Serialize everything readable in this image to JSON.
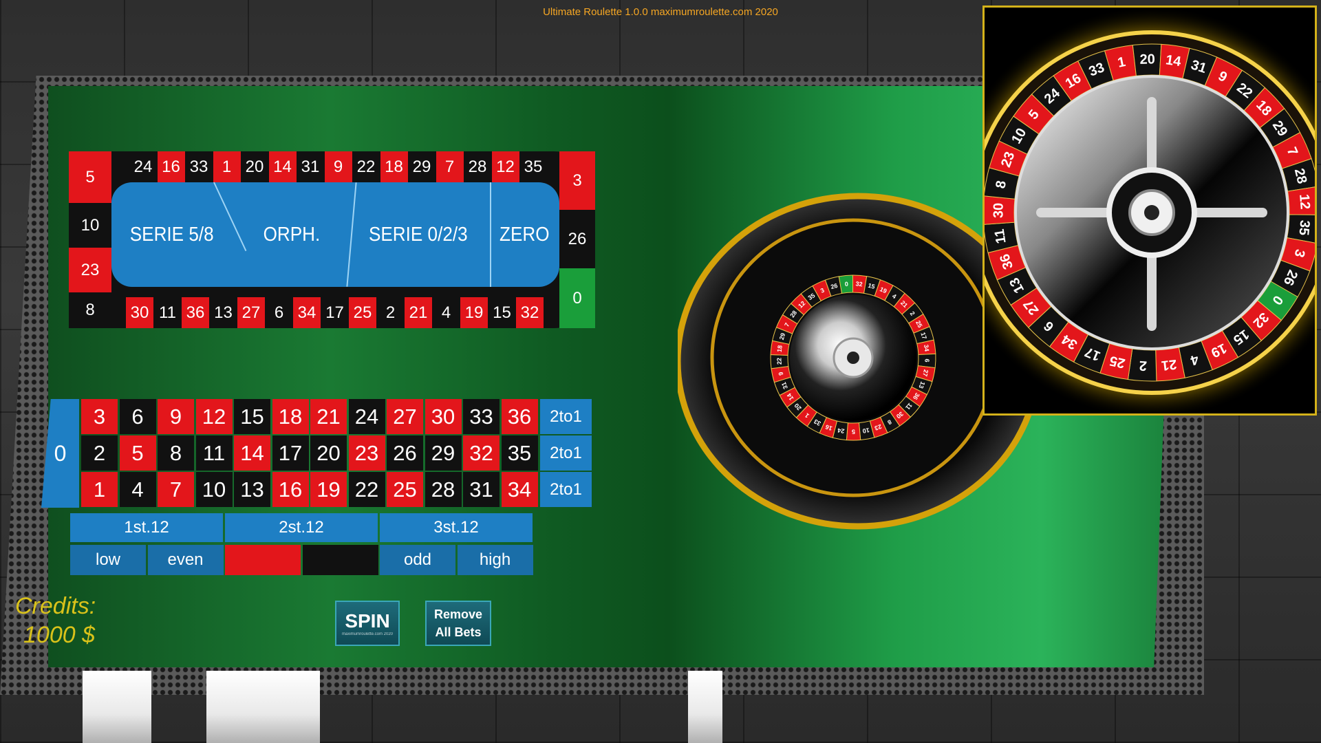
{
  "app": {
    "title": "Ultimate Roulette 1.0.0 maximumroulette.com 2020"
  },
  "racetrack": {
    "top": [
      {
        "n": "24",
        "c": "black"
      },
      {
        "n": "16",
        "c": "red"
      },
      {
        "n": "33",
        "c": "black"
      },
      {
        "n": "1",
        "c": "red"
      },
      {
        "n": "20",
        "c": "black"
      },
      {
        "n": "14",
        "c": "red"
      },
      {
        "n": "31",
        "c": "black"
      },
      {
        "n": "9",
        "c": "red"
      },
      {
        "n": "22",
        "c": "black"
      },
      {
        "n": "18",
        "c": "red"
      },
      {
        "n": "29",
        "c": "black"
      },
      {
        "n": "7",
        "c": "red"
      },
      {
        "n": "28",
        "c": "black"
      },
      {
        "n": "12",
        "c": "red"
      },
      {
        "n": "35",
        "c": "black"
      }
    ],
    "bottom": [
      {
        "n": "30",
        "c": "red"
      },
      {
        "n": "11",
        "c": "black"
      },
      {
        "n": "36",
        "c": "red"
      },
      {
        "n": "13",
        "c": "black"
      },
      {
        "n": "27",
        "c": "red"
      },
      {
        "n": "6",
        "c": "black"
      },
      {
        "n": "34",
        "c": "red"
      },
      {
        "n": "17",
        "c": "black"
      },
      {
        "n": "25",
        "c": "red"
      },
      {
        "n": "2",
        "c": "black"
      },
      {
        "n": "21",
        "c": "red"
      },
      {
        "n": "4",
        "c": "black"
      },
      {
        "n": "19",
        "c": "red"
      },
      {
        "n": "15",
        "c": "black"
      },
      {
        "n": "32",
        "c": "red"
      }
    ],
    "left": [
      {
        "n": "5",
        "c": "red"
      },
      {
        "n": "10",
        "c": "black"
      },
      {
        "n": "23",
        "c": "red"
      },
      {
        "n": "8",
        "c": "black"
      }
    ],
    "right": [
      {
        "n": "3",
        "c": "red"
      },
      {
        "n": "26",
        "c": "black"
      },
      {
        "n": "0",
        "c": "green"
      }
    ],
    "sectors": [
      "SERIE 5/8",
      "ORPH.",
      "SERIE 0/2/3",
      "ZERO"
    ]
  },
  "layout": {
    "zero": "0",
    "rows": [
      [
        {
          "n": "3",
          "c": "red"
        },
        {
          "n": "6",
          "c": "black"
        },
        {
          "n": "9",
          "c": "red"
        },
        {
          "n": "12",
          "c": "red"
        },
        {
          "n": "15",
          "c": "black"
        },
        {
          "n": "18",
          "c": "red"
        },
        {
          "n": "21",
          "c": "red"
        },
        {
          "n": "24",
          "c": "black"
        },
        {
          "n": "27",
          "c": "red"
        },
        {
          "n": "30",
          "c": "red"
        },
        {
          "n": "33",
          "c": "black"
        },
        {
          "n": "36",
          "c": "red"
        }
      ],
      [
        {
          "n": "2",
          "c": "black"
        },
        {
          "n": "5",
          "c": "red"
        },
        {
          "n": "8",
          "c": "black"
        },
        {
          "n": "11",
          "c": "black"
        },
        {
          "n": "14",
          "c": "red"
        },
        {
          "n": "17",
          "c": "black"
        },
        {
          "n": "20",
          "c": "black"
        },
        {
          "n": "23",
          "c": "red"
        },
        {
          "n": "26",
          "c": "black"
        },
        {
          "n": "29",
          "c": "black"
        },
        {
          "n": "32",
          "c": "red"
        },
        {
          "n": "35",
          "c": "black"
        }
      ],
      [
        {
          "n": "1",
          "c": "red"
        },
        {
          "n": "4",
          "c": "black"
        },
        {
          "n": "7",
          "c": "red"
        },
        {
          "n": "10",
          "c": "black"
        },
        {
          "n": "13",
          "c": "black"
        },
        {
          "n": "16",
          "c": "red"
        },
        {
          "n": "19",
          "c": "red"
        },
        {
          "n": "22",
          "c": "black"
        },
        {
          "n": "25",
          "c": "red"
        },
        {
          "n": "28",
          "c": "black"
        },
        {
          "n": "31",
          "c": "black"
        },
        {
          "n": "34",
          "c": "red"
        }
      ]
    ],
    "columns": [
      "2to1",
      "2to1",
      "2to1"
    ],
    "dozens": [
      "1st.12",
      "2st.12",
      "3st.12"
    ],
    "outside": [
      {
        "label": "low",
        "color": "#1a6ea8"
      },
      {
        "label": "even",
        "color": "#1a6ea8"
      },
      {
        "label": "",
        "color": "#e3161b"
      },
      {
        "label": "",
        "color": "#111111"
      },
      {
        "label": "odd",
        "color": "#1a6ea8"
      },
      {
        "label": "high",
        "color": "#1a6ea8"
      }
    ]
  },
  "credits": {
    "label": "Credits:",
    "value": "1000 $"
  },
  "buttons": {
    "spin": "SPIN",
    "spin_sub": "maximumroulette.com 2020",
    "remove_line1": "Remove",
    "remove_line2": "All Bets"
  },
  "wheel": {
    "sequence": [
      {
        "n": "0",
        "c": "green"
      },
      {
        "n": "32",
        "c": "red"
      },
      {
        "n": "15",
        "c": "black"
      },
      {
        "n": "19",
        "c": "red"
      },
      {
        "n": "4",
        "c": "black"
      },
      {
        "n": "21",
        "c": "red"
      },
      {
        "n": "2",
        "c": "black"
      },
      {
        "n": "25",
        "c": "red"
      },
      {
        "n": "17",
        "c": "black"
      },
      {
        "n": "34",
        "c": "red"
      },
      {
        "n": "6",
        "c": "black"
      },
      {
        "n": "27",
        "c": "red"
      },
      {
        "n": "13",
        "c": "black"
      },
      {
        "n": "36",
        "c": "red"
      },
      {
        "n": "11",
        "c": "black"
      },
      {
        "n": "30",
        "c": "red"
      },
      {
        "n": "8",
        "c": "black"
      },
      {
        "n": "23",
        "c": "red"
      },
      {
        "n": "10",
        "c": "black"
      },
      {
        "n": "5",
        "c": "red"
      },
      {
        "n": "24",
        "c": "black"
      },
      {
        "n": "16",
        "c": "red"
      },
      {
        "n": "33",
        "c": "black"
      },
      {
        "n": "1",
        "c": "red"
      },
      {
        "n": "20",
        "c": "black"
      },
      {
        "n": "14",
        "c": "red"
      },
      {
        "n": "31",
        "c": "black"
      },
      {
        "n": "9",
        "c": "red"
      },
      {
        "n": "22",
        "c": "black"
      },
      {
        "n": "18",
        "c": "red"
      },
      {
        "n": "29",
        "c": "black"
      },
      {
        "n": "7",
        "c": "red"
      },
      {
        "n": "28",
        "c": "black"
      },
      {
        "n": "12",
        "c": "red"
      },
      {
        "n": "35",
        "c": "black"
      },
      {
        "n": "3",
        "c": "red"
      },
      {
        "n": "26",
        "c": "black"
      }
    ]
  },
  "colors": {
    "red": "#e3161b",
    "black": "#111111",
    "green": "#1a9e3a",
    "blue": "#1e7fc4",
    "gold": "#d4b21a",
    "title": "#f5a623"
  }
}
